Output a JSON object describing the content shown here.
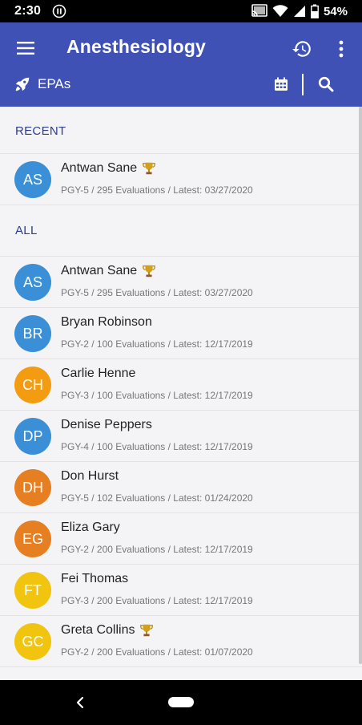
{
  "status_bar": {
    "time": "2:30",
    "battery": "54%"
  },
  "app_bar": {
    "title": "Anesthesiology",
    "subtitle": "EPAs"
  },
  "colors": {
    "primary": "#3f51b5",
    "section_header": "#2e3c8f",
    "avatar_blue": "#3b8fd6",
    "avatar_orange": "#e67e22",
    "avatar_yellow": "#f1c40f"
  },
  "sections": {
    "recent": {
      "header": "RECENT",
      "items": [
        {
          "initials": "AS",
          "name": "Antwan Sane",
          "trophy": true,
          "details": "PGY-5 / 295 Evaluations / Latest: 03/27/2020",
          "color": "#3b8fd6"
        }
      ]
    },
    "all": {
      "header": "ALL",
      "items": [
        {
          "initials": "AS",
          "name": "Antwan Sane",
          "trophy": true,
          "details": "PGY-5 / 295 Evaluations / Latest: 03/27/2020",
          "color": "#3b8fd6"
        },
        {
          "initials": "BR",
          "name": "Bryan Robinson",
          "trophy": false,
          "details": "PGY-2 / 100 Evaluations / Latest: 12/17/2019",
          "color": "#3b8fd6"
        },
        {
          "initials": "CH",
          "name": "Carlie Henne",
          "trophy": false,
          "details": "PGY-3 / 100 Evaluations / Latest: 12/17/2019",
          "color": "#f39c12"
        },
        {
          "initials": "DP",
          "name": "Denise Peppers",
          "trophy": false,
          "details": "PGY-4 / 100 Evaluations / Latest: 12/17/2019",
          "color": "#3b8fd6"
        },
        {
          "initials": "DH",
          "name": "Don Hurst",
          "trophy": false,
          "details": "PGY-5 / 102 Evaluations / Latest: 01/24/2020",
          "color": "#e67e22"
        },
        {
          "initials": "EG",
          "name": "Eliza Gary",
          "trophy": false,
          "details": "PGY-2 / 200 Evaluations / Latest: 12/17/2019",
          "color": "#e67e22"
        },
        {
          "initials": "FT",
          "name": "Fei Thomas",
          "trophy": false,
          "details": "PGY-3 / 200 Evaluations / Latest: 12/17/2019",
          "color": "#f1c40f"
        },
        {
          "initials": "GC",
          "name": "Greta Collins",
          "trophy": true,
          "details": "PGY-2 / 200 Evaluations / Latest: 01/07/2020",
          "color": "#f1c40f"
        }
      ]
    }
  },
  "icons": [
    "menu-icon",
    "history-icon",
    "more-vert-icon",
    "rocket-icon",
    "calendar-icon",
    "search-icon",
    "trophy-icon",
    "back-icon",
    "home-icon"
  ]
}
